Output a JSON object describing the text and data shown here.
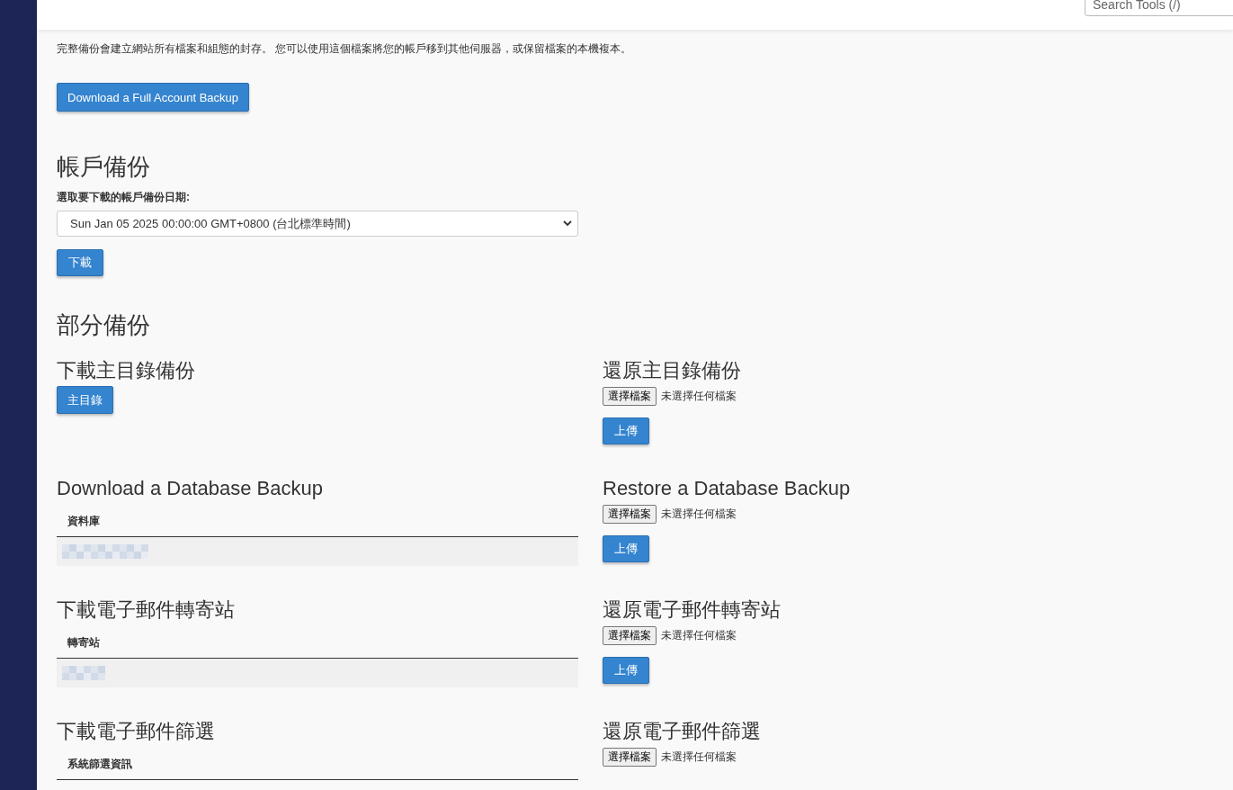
{
  "header": {
    "search": {
      "placeholder": "Search Tools (/)"
    }
  },
  "full_backup": {
    "description": "完整備份會建立網站所有檔案和組態的封存。 您可以使用這個檔案將您的帳戶移到其他伺服器，或保留檔案的本機複本。",
    "button": "Download a Full Account Backup"
  },
  "account_backup": {
    "title": "帳戶備份",
    "label": "選取要下載的帳戶備份日期:",
    "select_value": "Sun Jan 05 2025 00:00:00 GMT+0800 (台北標準時間)",
    "button": "下載"
  },
  "partial_backup": {
    "title": "部分備份",
    "sections": [
      {
        "download": {
          "title": "下載主目錄備份",
          "kind": "button",
          "button": "主目錄"
        },
        "restore": {
          "title": "還原主目錄備份",
          "choose_button": "選擇檔案",
          "no_file": "未選擇任何檔案",
          "upload_button": "上傳"
        }
      },
      {
        "download": {
          "title": "Download a Database Backup",
          "kind": "table",
          "column": "資料庫",
          "rows": [
            {
              "kind": "redacted_long"
            }
          ]
        },
        "restore": {
          "title": "Restore a Database Backup",
          "choose_button": "選擇檔案",
          "no_file": "未選擇任何檔案",
          "upload_button": "上傳"
        }
      },
      {
        "download": {
          "title": "下載電子郵件轉寄站",
          "kind": "table",
          "column": "轉寄站",
          "rows": [
            {
              "kind": "redacted_short"
            }
          ]
        },
        "restore": {
          "title": "還原電子郵件轉寄站",
          "choose_button": "選擇檔案",
          "no_file": "未選擇任何檔案",
          "upload_button": "上傳"
        }
      },
      {
        "download": {
          "title": "下載電子郵件篩選",
          "kind": "table",
          "column": "系統篩選資訊"
        },
        "restore": {
          "title": "還原電子郵件篩選",
          "choose_button": "選擇檔案",
          "no_file": "未選擇任何檔案"
        }
      }
    ]
  }
}
